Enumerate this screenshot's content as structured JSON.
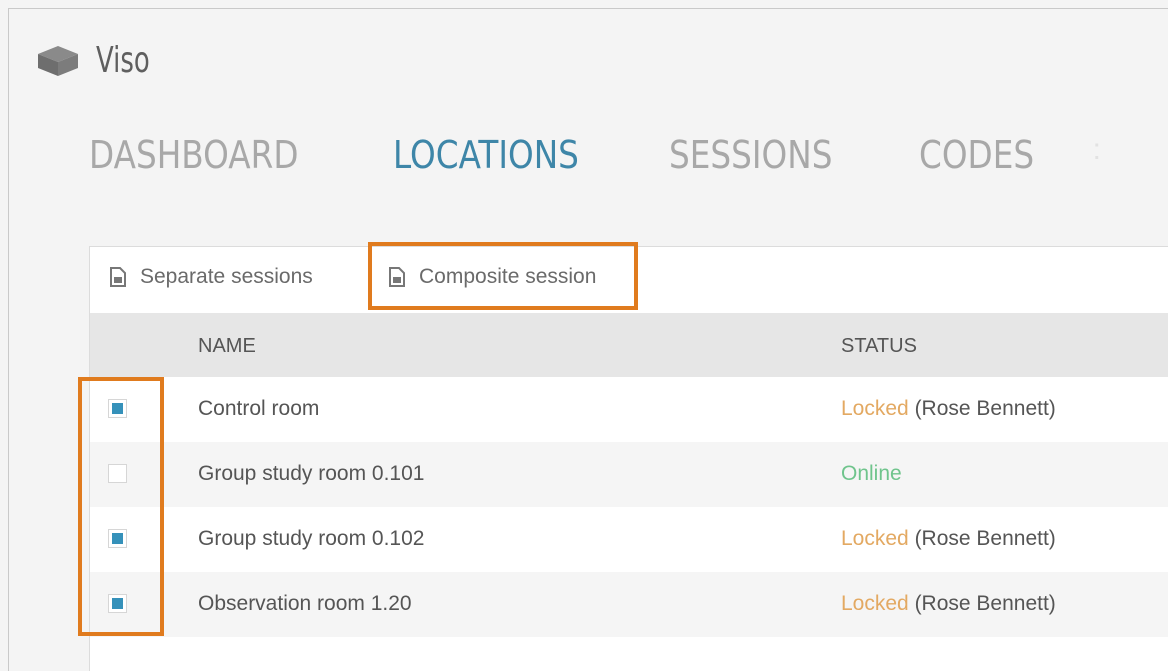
{
  "app": {
    "name": "Viso",
    "logo_icon": "cube-logo-icon"
  },
  "nav": {
    "tabs": [
      {
        "label": "DASHBOARD",
        "active": false
      },
      {
        "label": "LOCATIONS",
        "active": true
      },
      {
        "label": "SESSIONS",
        "active": false
      },
      {
        "label": "CODES",
        "active": false
      }
    ]
  },
  "toolbar": {
    "separate_label": "Separate sessions",
    "composite_label": "Composite session",
    "icon": "document-icon"
  },
  "table": {
    "columns": {
      "name": "NAME",
      "status": "STATUS"
    },
    "rows": [
      {
        "name": "Control room",
        "status": "Locked",
        "status_kind": "locked",
        "locked_by": "(Rose Bennett)",
        "checked": true
      },
      {
        "name": "Group study room 0.101",
        "status": "Online",
        "status_kind": "online",
        "locked_by": "",
        "checked": false
      },
      {
        "name": "Group study room 0.102",
        "status": "Locked",
        "status_kind": "locked",
        "locked_by": "(Rose Bennett)",
        "checked": true
      },
      {
        "name": "Observation room 1.20",
        "status": "Locked",
        "status_kind": "locked",
        "locked_by": "(Rose Bennett)",
        "checked": true
      }
    ]
  },
  "colors": {
    "accent": "#3e86a8",
    "checkbox_fill": "#3591ba",
    "locked": "#e3a962",
    "online": "#6fc48c",
    "highlight": "#e07b1e"
  }
}
